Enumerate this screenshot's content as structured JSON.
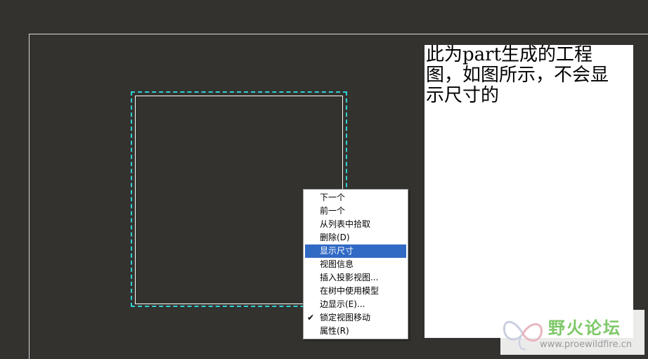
{
  "drawing": {
    "note_text": "此为part生成的工程图，如图所示，不会显示尺寸的"
  },
  "context_menu": {
    "items": [
      {
        "label": "下一个",
        "checked": false,
        "highlighted": false
      },
      {
        "label": "前一个",
        "checked": false,
        "highlighted": false
      },
      {
        "label": "从列表中拾取",
        "checked": false,
        "highlighted": false
      },
      {
        "label": "删除(D)",
        "checked": false,
        "highlighted": false
      },
      {
        "label": "显示尺寸",
        "checked": false,
        "highlighted": true
      },
      {
        "label": "视图信息",
        "checked": false,
        "highlighted": false
      },
      {
        "label": "插入投影视图...",
        "checked": false,
        "highlighted": false
      },
      {
        "label": "在树中使用模型",
        "checked": false,
        "highlighted": false
      },
      {
        "label": "边显示(E)...",
        "checked": false,
        "highlighted": false
      },
      {
        "label": "锁定视图移动",
        "checked": true,
        "highlighted": false
      },
      {
        "label": "属性(R)",
        "checked": false,
        "highlighted": false
      }
    ],
    "check_glyph": "✔"
  },
  "watermark": {
    "title": "野火论坛",
    "url": "www.proewildfire.cn",
    "logo_icon": "butterfly-logo-icon"
  },
  "colors": {
    "background": "#33322e",
    "view_boundary": "#2fd0d6",
    "highlight": "#316ac5"
  }
}
